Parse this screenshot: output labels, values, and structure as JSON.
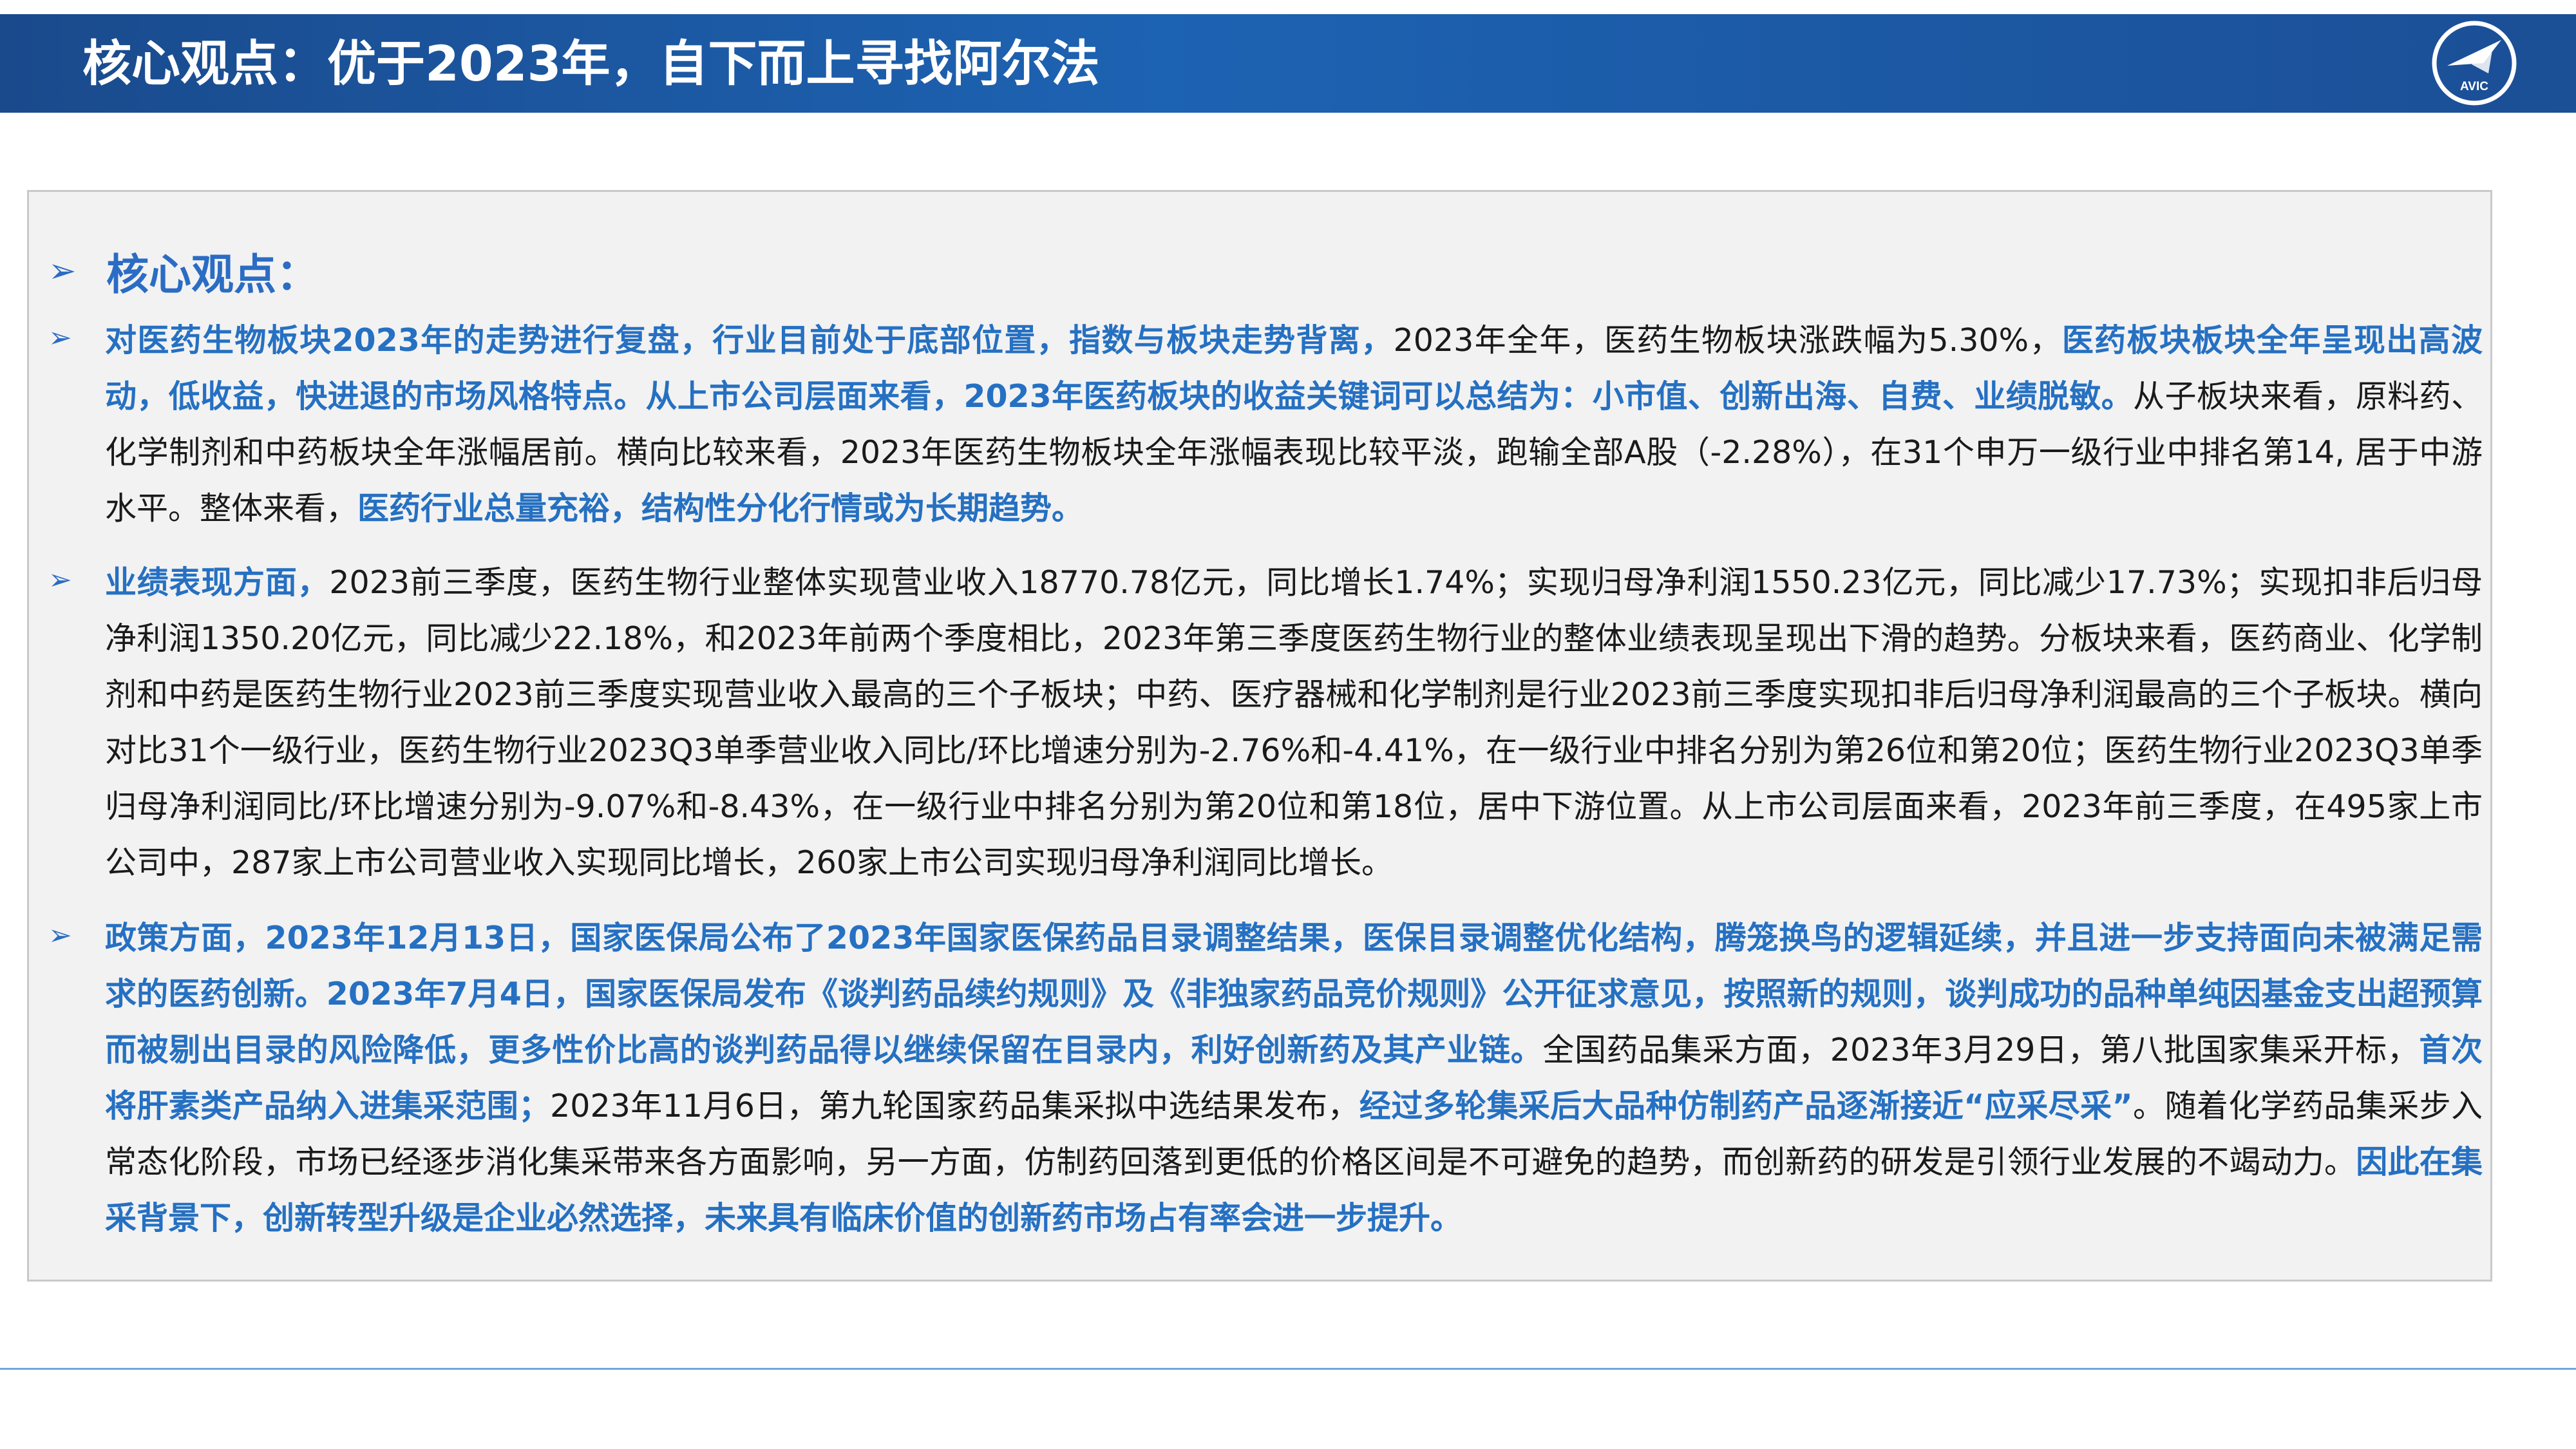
{
  "header": {
    "title": "核心观点：优于2023年，自下而上寻找阿尔法",
    "logo_text": "AVIC",
    "accent": "#1d63b3"
  },
  "section": {
    "heading": "核心观点：",
    "bullet_icon": "arrow-bullet-icon",
    "highlight_color": "#2570c2"
  },
  "bullets": [
    [
      {
        "t": "对医药生物板块2023年的走势进行复盘，行业目前处于底部位置，指数与板块走势背离，",
        "h": true
      },
      {
        "t": "2023年全年，医药生物板块涨跌幅为5.30%，",
        "h": false
      },
      {
        "t": "医药板块板块全年呈现出高波动，低收益，快进退的市场风格特点。从上市公司层面来看，2023年医药板块的收益关键词可以总结为：小市值、创新出海、自费、业绩脱敏。",
        "h": true
      },
      {
        "t": "从子板块来看，原料药、化学制剂和中药板块全年涨幅居前。横向比较来看，2023年医药生物板块全年涨幅表现比较平淡，跑输全部A股（-2.28%），在31个申万一级行业中排名第14, 居于中游水平。整体来看，",
        "h": false
      },
      {
        "t": "医药行业总量充裕，结构性分化行情或为长期趋势。",
        "h": true
      }
    ],
    [
      {
        "t": "业绩表现方面，",
        "h": true
      },
      {
        "t": "2023前三季度，医药生物行业整体实现营业收入18770.78亿元，同比增长1.74%；实现归母净利润1550.23亿元，同比减少17.73%；实现扣非后归母净利润1350.20亿元，同比减少22.18%，和2023年前两个季度相比，2023年第三季度医药生物行业的整体业绩表现呈现出下滑的趋势。分板块来看，医药商业、化学制剂和中药是医药生物行业2023前三季度实现营业收入最高的三个子板块；中药、医疗器械和化学制剂是行业2023前三季度实现扣非后归母净利润最高的三个子板块。横向对比31个一级行业，医药生物行业2023Q3单季营业收入同比/环比增速分别为-2.76%和-4.41%，在一级行业中排名分别为第26位和第20位；医药生物行业2023Q3单季归母净利润同比/环比增速分别为-9.07%和-8.43%，在一级行业中排名分别为第20位和第18位，居中下游位置。从上市公司层面来看，2023年前三季度，在495家上市公司中，287家上市公司营业收入实现同比增长，260家上市公司实现归母净利润同比增长。",
        "h": false
      }
    ],
    [
      {
        "t": "政策方面，2023年12月13日，国家医保局公布了2023年国家医保药品目录调整结果，医保目录调整优化结构，腾笼换鸟的逻辑延续，并且进一步支持面向未被满足需求的医药创新。2023年7月4日，国家医保局发布《谈判药品续约规则》及《非独家药品竞价规则》公开征求意见，按照新的规则，谈判成功的品种单纯因基金支出超预算而被剔出目录的风险降低，更多性价比高的谈判药品得以继续保留在目录内，利好创新药及其产业链。",
        "h": true
      },
      {
        "t": "全国药品集采方面，2023年3月29日，第八批国家集采开标，",
        "h": false
      },
      {
        "t": "首次将肝素类产品纳入进集采范围；",
        "h": true
      },
      {
        "t": "2023年11月6日，第九轮国家药品集采拟中选结果发布，",
        "h": false
      },
      {
        "t": "经过多轮集采后大品种仿制药产品逐渐接近“应采尽采”",
        "h": true
      },
      {
        "t": "。随着化学药品集采步入常态化阶段，市场已经逐步消化集采带来各方面影响，另一方面，仿制药回落到更低的价格区间是不可避免的趋势，而创新药的研发是引领行业发展的不竭动力。",
        "h": false
      },
      {
        "t": "因此在集采背景下，创新转型升级是企业必然选择，未来具有临床价值的创新药市场占有率会进一步提升。",
        "h": true
      }
    ]
  ]
}
